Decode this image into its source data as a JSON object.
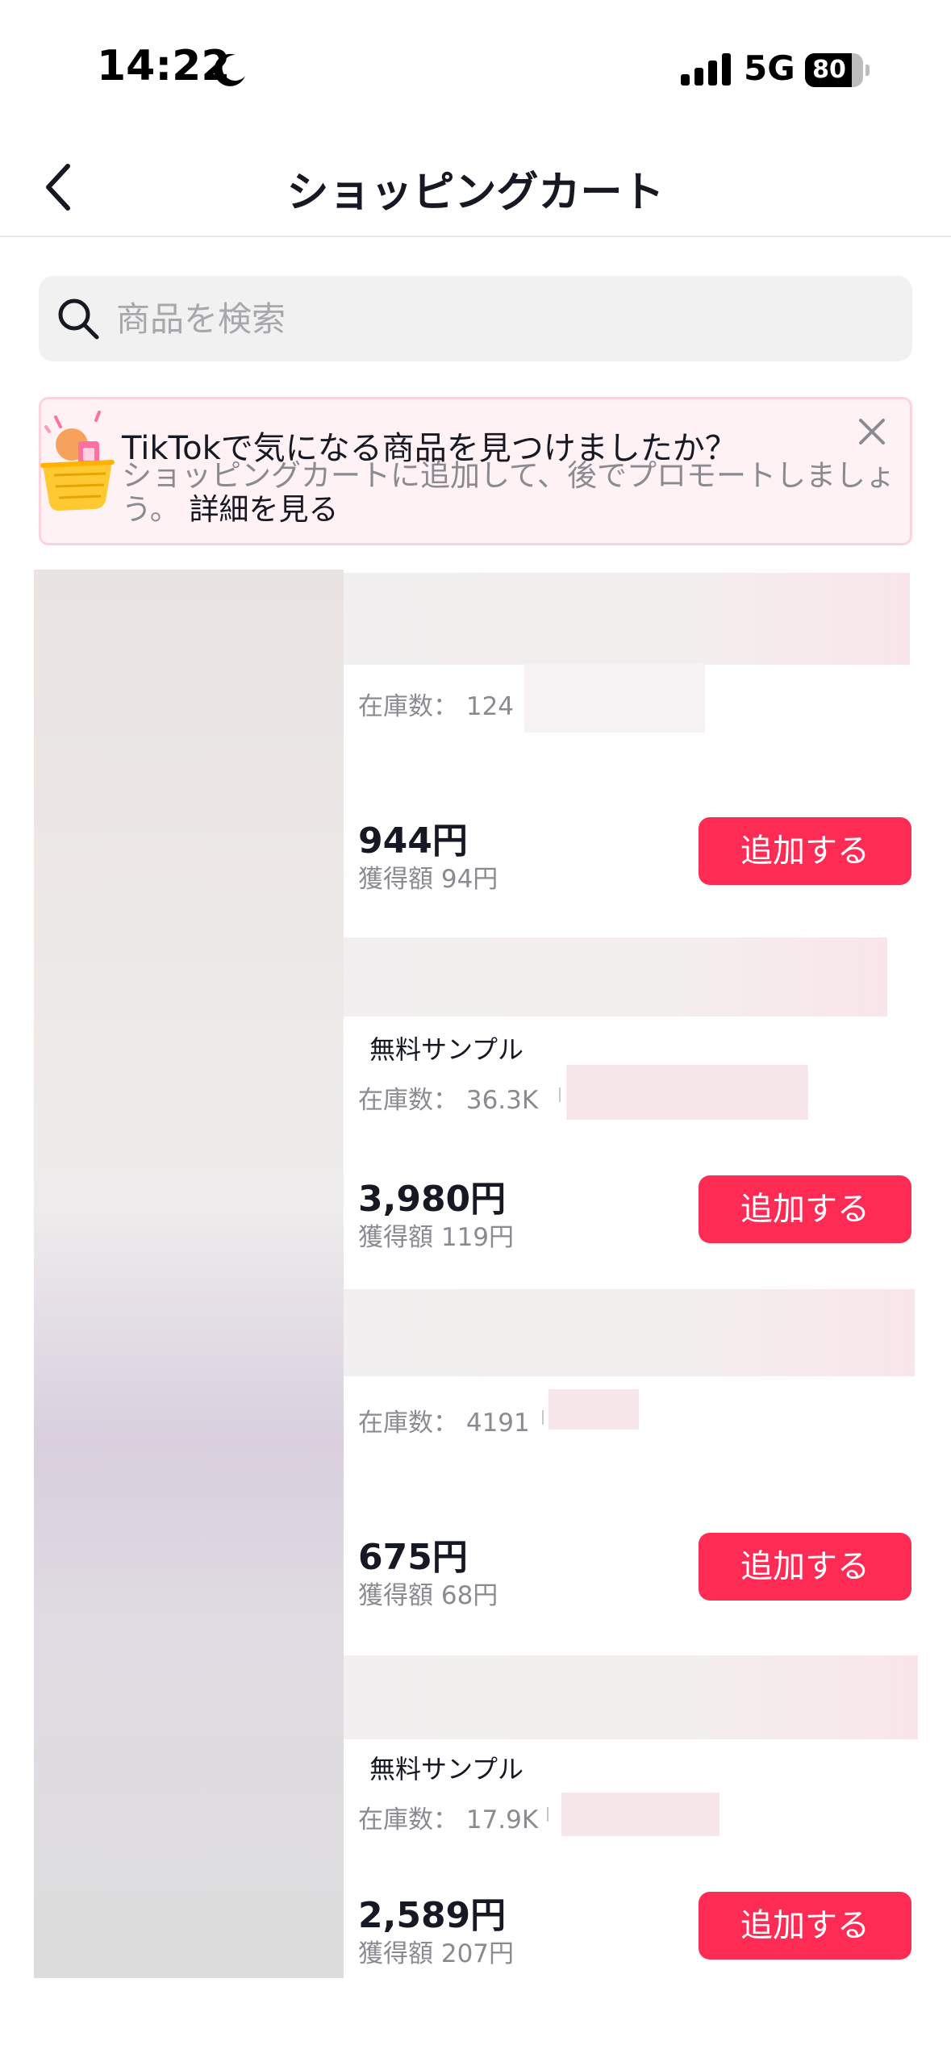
{
  "status_bar": {
    "time": "14:22",
    "network": "5G",
    "battery": "80",
    "battery_level": 0.8
  },
  "header": {
    "title": "ショッピングカート"
  },
  "search": {
    "placeholder": "商品を検索"
  },
  "promo": {
    "title": "TikTokで気になる商品を見つけましたか？",
    "body": "ショッピングカートに追加して、後でプロモートしましょう。",
    "link": "詳細を見る"
  },
  "products": [
    {
      "sample": "",
      "stock": "在庫数： 124",
      "price": "944円",
      "earn": "獲得額 94円",
      "button": "追加する"
    },
    {
      "sample": "無料サンプル",
      "stock": "在庫数： 36.3K",
      "price": "3,980円",
      "earn": "獲得額 119円",
      "button": "追加する"
    },
    {
      "sample": "",
      "stock": "在庫数： 4191",
      "price": "675円",
      "earn": "獲得額 68円",
      "button": "追加する"
    },
    {
      "sample": "無料サンプル",
      "stock": "在庫数： 17.9K",
      "price": "2,589円",
      "earn": "獲得額 207円",
      "button": "追加する"
    }
  ],
  "colors": {
    "accent": "#fe2c55",
    "promo_background": "#fff2f4",
    "search_background": "#f1f1f2"
  },
  "icons": [
    "moon-icon",
    "signal-icon",
    "back-icon",
    "search-icon",
    "close-icon",
    "shopping-basket-icon"
  ]
}
